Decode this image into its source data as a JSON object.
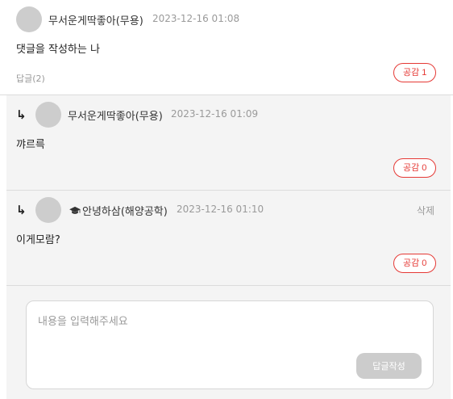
{
  "comments": [
    {
      "author": "무서운게딱좋아(무용)",
      "date": "2023-12-16 01:08",
      "text": "댓글을 작성하는 나",
      "reply_count": "답글(2)",
      "like_label": "공감 1"
    },
    {
      "arrow": "↳",
      "author": "무서운게딱좋아(무용)",
      "date": "2023-12-16 01:09",
      "text": "꺄르륵",
      "like_label": "공감 0"
    },
    {
      "arrow": "↳",
      "badge_icon": "graduation-cap-icon",
      "author": "안녕하삼(해양공학)",
      "date": "2023-12-16 01:10",
      "text": "이게모람?",
      "delete_label": "삭제",
      "like_label": "공감 0"
    }
  ],
  "composer": {
    "placeholder": "내용을 입력해주세요",
    "submit_label": "답글작성"
  },
  "colors": {
    "accent": "#e53935",
    "reply_bg": "#f4f4f4",
    "avatar": "#cdcdcd",
    "submit_disabled": "#cccccc"
  }
}
